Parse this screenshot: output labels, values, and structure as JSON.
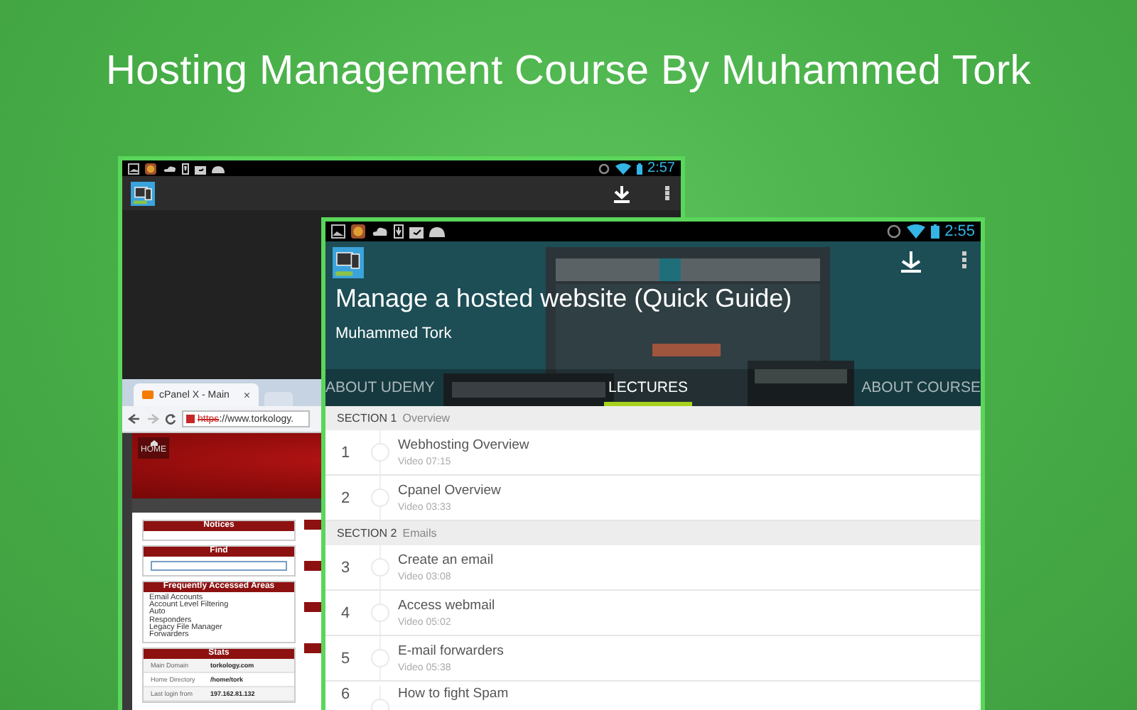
{
  "headline": "Hosting Management Course By Muhammed Tork",
  "back_screen": {
    "status_bar": {
      "time": "2:57"
    },
    "browser": {
      "tab_title": "cPanel X - Main",
      "tab_close": "×",
      "url_scheme": "https",
      "url_rest": "://www.torkology.",
      "page": {
        "home_label": "HOME",
        "panels": [
          {
            "kind": "empty",
            "title": "Notices"
          },
          {
            "kind": "search",
            "title": "Find"
          },
          {
            "kind": "links",
            "title": "Frequently Accessed Areas",
            "items": [
              "Email Accounts",
              "Account Level Filtering",
              "Auto",
              "Responders",
              "Legacy File Manager",
              "Forwarders"
            ]
          },
          {
            "kind": "table",
            "title": "Stats",
            "rows": [
              {
                "label": "Main Domain",
                "value": "torkology.com"
              },
              {
                "label": "Home Directory",
                "value": "/home/tork"
              },
              {
                "label": "Last login from",
                "value": "197.162.81.132"
              }
            ]
          }
        ]
      }
    }
  },
  "front_screen": {
    "status_bar": {
      "time": "2:55"
    },
    "course_title": "Manage a hosted website (Quick Guide)",
    "author": "Muhammed Tork",
    "tabs": [
      {
        "label": "ABOUT UDEMY",
        "selected": false
      },
      {
        "label": "LECTURES",
        "selected": true
      },
      {
        "label": "ABOUT COURSE",
        "selected": false
      }
    ],
    "sections": [
      {
        "label": "SECTION 1",
        "title": "Overview",
        "lectures": [
          {
            "number": "1",
            "title": "Webhosting Overview",
            "meta": "Video 07:15"
          },
          {
            "number": "2",
            "title": "Cpanel Overview",
            "meta": "Video 03:33"
          }
        ]
      },
      {
        "label": "SECTION 2",
        "title": "Emails",
        "lectures": [
          {
            "number": "3",
            "title": "Create an email",
            "meta": "Video 03:08"
          },
          {
            "number": "4",
            "title": "Access webmail",
            "meta": "Video 05:02"
          },
          {
            "number": "5",
            "title": "E-mail forwarders",
            "meta": "Video 05:38"
          },
          {
            "number": "6",
            "title": "How to fight Spam"
          }
        ]
      }
    ]
  }
}
